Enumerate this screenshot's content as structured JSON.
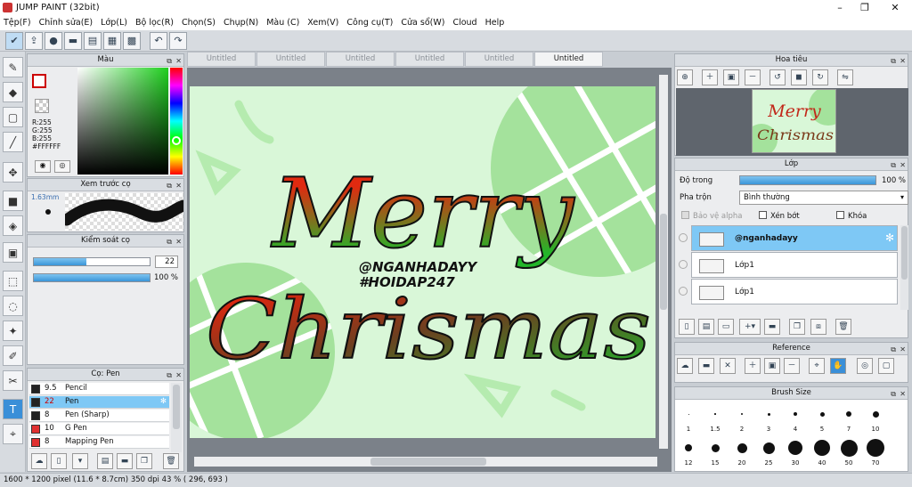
{
  "window": {
    "title": "JUMP PAINT (32bit)",
    "minimize": "–",
    "maximize": "❐",
    "close": "✕"
  },
  "menu": [
    "Tệp(F)",
    "Chỉnh sửa(E)",
    "Lớp(L)",
    "Bộ lọc(R)",
    "Chọn(S)",
    "Chụp(N)",
    "Màu (C)",
    "Xem(V)",
    "Công cụ(T)",
    "Cửa sổ(W)",
    "Cloud",
    "Help"
  ],
  "toolbar_icons": [
    "checkmark-icon",
    "export-icon",
    "speech-bubble-icon",
    "comment-icon",
    "page-icon",
    "layout-icon",
    "grid-icon"
  ],
  "undo_icon": "↶",
  "redo_icon": "↷",
  "color_panel": {
    "title": "Màu",
    "r": "R:255",
    "g": "G:255",
    "b": "B:255",
    "hex": "#FFFFFF"
  },
  "preview_panel": {
    "title": "Xem trước cọ",
    "size": "1.63mm"
  },
  "control_panel": {
    "title": "Kiểm soát cọ",
    "size_value": "22",
    "size_fraction": 0.45,
    "opacity_value": "100 %",
    "opacity_fraction": 1.0
  },
  "brush_panel": {
    "title": "Cọ: Pen",
    "items": [
      {
        "size": "9.5",
        "name": "Pencil",
        "color": "#222222",
        "selected": false
      },
      {
        "size": "22",
        "name": "Pen",
        "color": "#222222",
        "selected": true
      },
      {
        "size": "8",
        "name": "Pen (Sharp)",
        "color": "#222222",
        "selected": false
      },
      {
        "size": "10",
        "name": "G Pen",
        "color": "#e03030",
        "selected": false
      },
      {
        "size": "8",
        "name": "Mapping Pen",
        "color": "#e03030",
        "selected": false
      }
    ]
  },
  "tabs": [
    "Untitled",
    "Untitled",
    "Untitled",
    "Untitled",
    "Untitled",
    "Untitled"
  ],
  "active_tab": 5,
  "canvas": {
    "line1": "Merry",
    "line2": "Chrismas",
    "handle": "@NGANHADAYY",
    "hashtag": "#HOIDAP247",
    "bg_color": "#d9f7d8",
    "shape_color": "#a8e6a0"
  },
  "navigator_panel": {
    "title": "Hoa tiêu"
  },
  "layer_panel": {
    "title": "Lớp",
    "opacity_label": "Độ trong",
    "opacity_value": "100 %",
    "opacity_fraction": 1.0,
    "blend_label": "Pha trộn",
    "blend_value": "Bình thường",
    "protect_alpha": "Bảo vệ alpha",
    "clipping": "Xén bớt",
    "lock": "Khóa",
    "layers": [
      {
        "name": "@nganhadayy",
        "selected": true
      },
      {
        "name": "Lớp1",
        "selected": false
      },
      {
        "name": "Lớp1",
        "selected": false
      }
    ]
  },
  "reference_panel": {
    "title": "Reference"
  },
  "brush_size_panel": {
    "title": "Brush Size",
    "row1": [
      "1",
      "1.5",
      "2",
      "3",
      "4",
      "5",
      "7",
      "10"
    ],
    "row2": [
      "12",
      "15",
      "20",
      "25",
      "30",
      "40",
      "50",
      "70"
    ]
  },
  "status": {
    "text": "1600 * 1200 pixel   (11.6 * 8.7cm)  350 dpi   43 %   ( 296, 693 )"
  }
}
